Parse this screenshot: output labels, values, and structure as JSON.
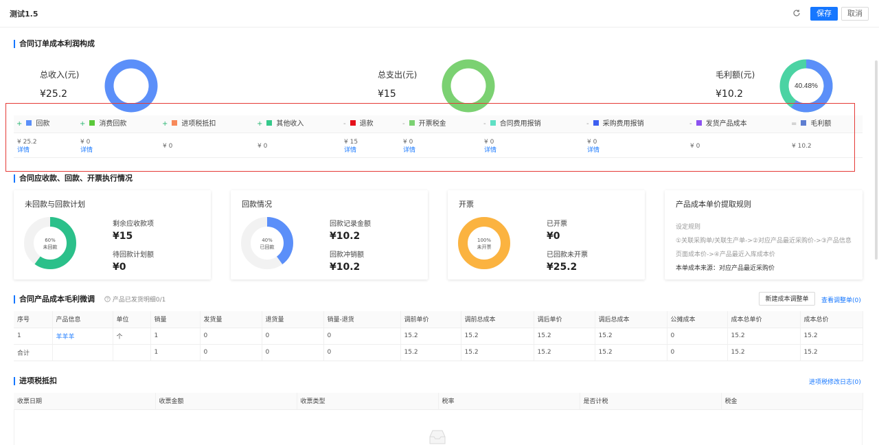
{
  "header": {
    "title": "测试1.5",
    "save_label": "保存",
    "cancel_label": "取消"
  },
  "section1": {
    "title": "合同订单成本利润构成",
    "summary": [
      {
        "label": "总收入(元)",
        "value": "¥25.2",
        "color": "#5b8ff9"
      },
      {
        "label": "总支出(元)",
        "value": "¥15",
        "color": "#7bd172"
      },
      {
        "label": "毛利额(元)",
        "value": "¥10.2",
        "center": "40.48%",
        "percent": 40.48
      }
    ],
    "legend": [
      {
        "op": "+",
        "label": "回款",
        "color": "#5b8ff9"
      },
      {
        "op": "+",
        "label": "消费回款",
        "color": "#5ac83a"
      },
      {
        "op": "+",
        "label": "进项税抵扣",
        "color": "#f7895a"
      },
      {
        "op": "+",
        "label": "其他收入",
        "color": "#35c98b"
      },
      {
        "op": "-",
        "label": "退款",
        "color": "#e5101a"
      },
      {
        "op": "-",
        "label": "开票税金",
        "color": "#7bd172"
      },
      {
        "op": "-",
        "label": "合同费用报销",
        "color": "#5fe0c4"
      },
      {
        "op": "-",
        "label": "采购费用报销",
        "color": "#3d5ff0"
      },
      {
        "op": "-",
        "label": "发货产品成本",
        "color": "#8c52f0"
      },
      {
        "op": "=",
        "label": "毛利额",
        "color": "#5e7ed1"
      }
    ],
    "values": [
      {
        "value": "¥ 25.2",
        "detail": "详情"
      },
      {
        "value": "¥ 0",
        "detail": "详情"
      },
      {
        "value": "¥ 0",
        "detail": ""
      },
      {
        "value": "¥ 0",
        "detail": ""
      },
      {
        "value": "¥ 15",
        "detail": "详情"
      },
      {
        "value": "¥ 0",
        "detail": "详情"
      },
      {
        "value": "¥ 0",
        "detail": "详情"
      },
      {
        "value": "¥ 0",
        "detail": "详情"
      },
      {
        "value": "¥ 0",
        "detail": ""
      },
      {
        "value": "¥ 10.2",
        "detail": ""
      }
    ]
  },
  "section2": {
    "title": "合同应收款、回款、开票执行情况",
    "cards": [
      {
        "title": "未回款与回款计划",
        "ring_pct": "60%",
        "ring_sub": "未回款",
        "ring_fraction": 0.6,
        "ring_color": "#2bc08a",
        "k1": "剩余应收款项",
        "v1": "¥15",
        "k2": "待回款计划额",
        "v2": "¥0"
      },
      {
        "title": "回款情况",
        "ring_pct": "40%",
        "ring_sub": "已回款",
        "ring_fraction": 0.4,
        "ring_color": "#5b8ff9",
        "k1": "回款记录金额",
        "v1": "¥10.2",
        "k2": "回款冲销额",
        "v2": "¥10.2"
      },
      {
        "title": "开票",
        "ring_pct": "100%",
        "ring_sub": "未开票",
        "ring_fraction": 1.0,
        "ring_color": "#fbb340",
        "k1": "已开票",
        "v1": "¥0",
        "k2": "已回款未开票",
        "v2": "¥25.2"
      }
    ],
    "rule_card": {
      "title": "产品成本单价提取规则",
      "lines": [
        "设定规则",
        "①关联采购单/关联生产单->②对应产品最近采购价->③产品信息",
        "页面成本价->④产品最近入库成本价"
      ],
      "source": "本单成本来源：对应产品最近采购价"
    }
  },
  "section3": {
    "title": "合同产品成本毛利微调",
    "hint": "产品已发货明细0/1",
    "new_button": "新建成本调整单",
    "view_link": "查看调整单(0)",
    "columns": [
      "序号",
      "产品信息",
      "单位",
      "销量",
      "发货量",
      "退货量",
      "销量-退货",
      "调前单价",
      "调前总成本",
      "调后单价",
      "调后总成本",
      "公摊成本",
      "成本总单价",
      "成本总价"
    ],
    "rows": [
      [
        "1",
        "羊羊羊",
        "个",
        "1",
        "0",
        "0",
        "0",
        "15.2",
        "15.2",
        "15.2",
        "15.2",
        "0",
        "15.2",
        "15.2"
      ],
      [
        "合计",
        "",
        "",
        "1",
        "0",
        "0",
        "0",
        "15.2",
        "15.2",
        "15.2",
        "15.2",
        "0",
        "15.2",
        "15.2"
      ]
    ]
  },
  "section4": {
    "title": "进项税抵扣",
    "log_link": "进项税修改日志(0)",
    "columns": [
      "收票日期",
      "收票金额",
      "收票类型",
      "税率",
      "是否计税",
      "税金"
    ]
  }
}
